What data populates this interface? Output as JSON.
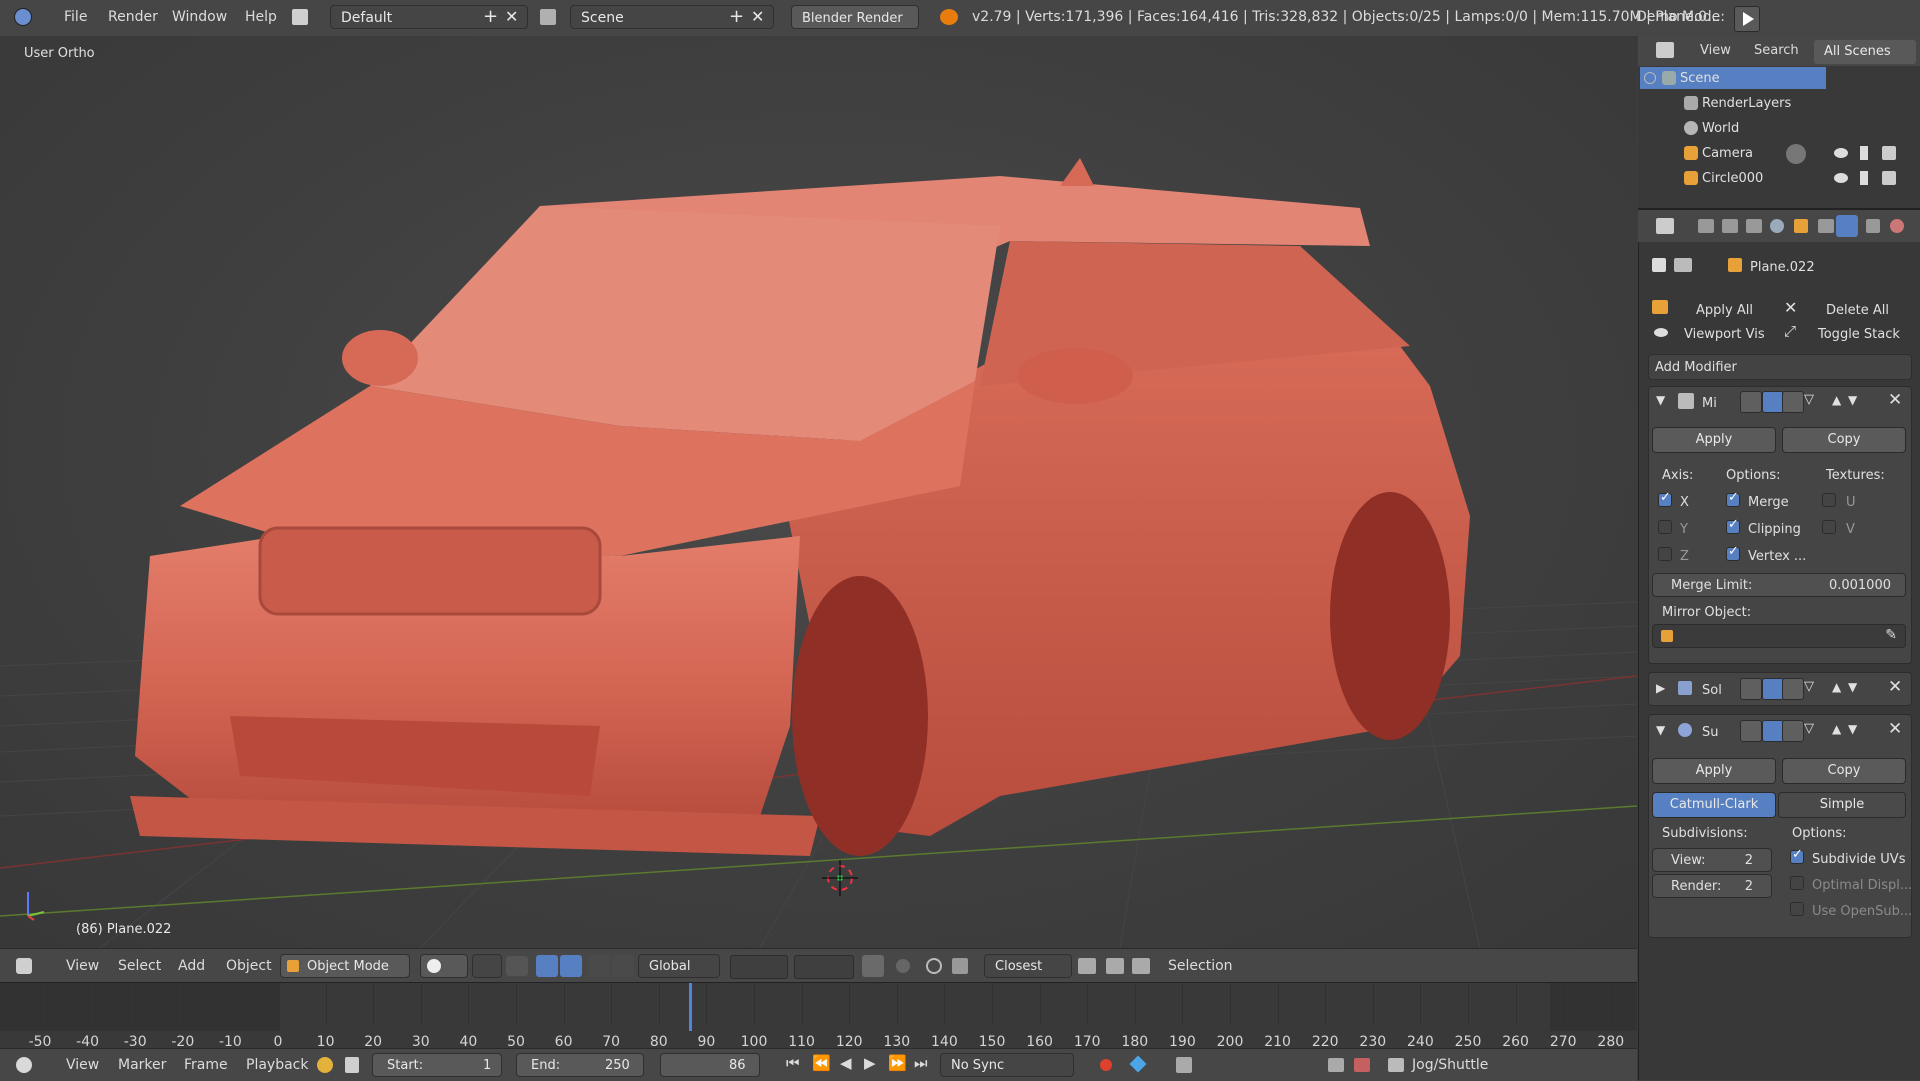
{
  "topbar": {
    "menus": [
      "File",
      "Render",
      "Window",
      "Help"
    ],
    "layout": "Default",
    "scene": "Scene",
    "engine": "Blender Render",
    "stats": "v2.79 | Verts:171,396 | Faces:164,416 | Tris:328,832 | Objects:0/25 | Lamps:0/0 | Mem:115.70M | Plane.0...",
    "demo_mode": "Demo Mode:"
  },
  "viewport": {
    "view_label": "User Ortho",
    "object_label": "(86) Plane.022"
  },
  "header3d": {
    "menus": [
      "View",
      "Select",
      "Add",
      "Object"
    ],
    "mode": "Object Mode",
    "orientation": "Global",
    "snap": "Closest",
    "selection": "Selection"
  },
  "timeline": {
    "ticks": [
      "-50",
      "-40",
      "-30",
      "-20",
      "-10",
      "0",
      "10",
      "20",
      "30",
      "40",
      "50",
      "60",
      "70",
      "80",
      "90",
      "100",
      "110",
      "120",
      "130",
      "140",
      "150",
      "160",
      "170",
      "180",
      "190",
      "200",
      "210",
      "220",
      "230",
      "240",
      "250",
      "260",
      "270",
      "280"
    ],
    "current_frame": 86
  },
  "timeline_header": {
    "menus": [
      "View",
      "Marker",
      "Frame",
      "Playback"
    ],
    "start_label": "Start:",
    "start_value": "1",
    "end_label": "End:",
    "end_value": "250",
    "current": "86",
    "sync": "No Sync",
    "jog": "Jog/Shuttle"
  },
  "outliner": {
    "tabs": [
      "View",
      "Search",
      "All Scenes"
    ],
    "items": [
      "Scene",
      "RenderLayers",
      "World",
      "Camera",
      "Circle000"
    ]
  },
  "properties": {
    "object_name": "Plane.022",
    "apply_all": "Apply All",
    "delete_all": "Delete All",
    "viewport_vis": "Viewport Vis",
    "toggle_stack": "Toggle Stack",
    "add_modifier": "Add Modifier",
    "mirror": {
      "name": "Mi",
      "apply": "Apply",
      "copy": "Copy",
      "axis_label": "Axis:",
      "options_label": "Options:",
      "textures_label": "Textures:",
      "x": "X",
      "y": "Y",
      "z": "Z",
      "merge": "Merge",
      "clipping": "Clipping",
      "vertex": "Vertex ...",
      "u": "U",
      "v": "V",
      "merge_limit_label": "Merge Limit:",
      "merge_limit_value": "0.001000",
      "mirror_object_label": "Mirror Object:"
    },
    "solidify": {
      "name": "Sol"
    },
    "subsurf": {
      "name": "Su",
      "apply": "Apply",
      "copy": "Copy",
      "catmull": "Catmull-Clark",
      "simple": "Simple",
      "subdivisions_label": "Subdivisions:",
      "options_label": "Options:",
      "view_label": "View:",
      "view_value": "2",
      "render_label": "Render:",
      "render_value": "2",
      "subdivide_uvs": "Subdivide UVs",
      "optimal_display": "Optimal Displ...",
      "use_opensubdiv": "Use OpenSub..."
    }
  }
}
